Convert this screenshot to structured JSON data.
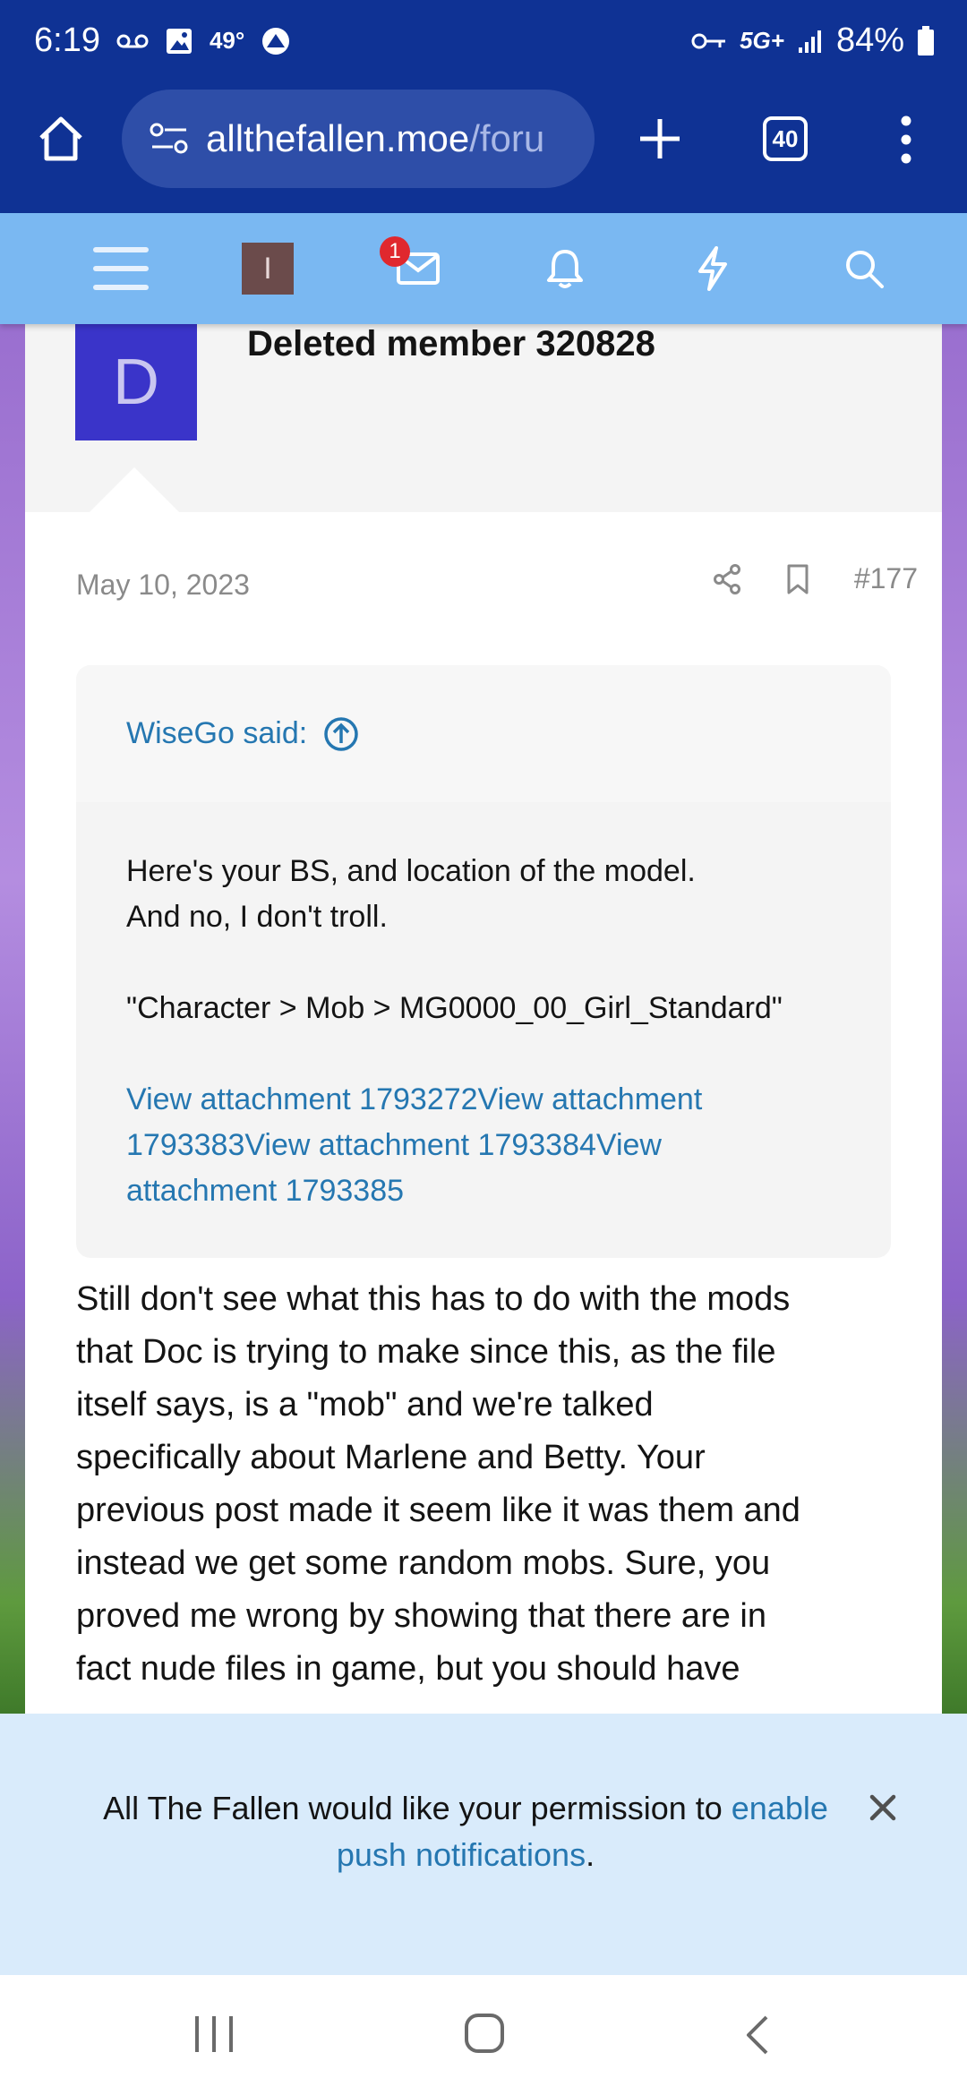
{
  "status_bar": {
    "time": "6:19",
    "temperature": "49°",
    "network": "5G+",
    "battery": "84%"
  },
  "browser": {
    "url_host": "allthefallen.moe",
    "url_path": "/foru",
    "tab_count": "40"
  },
  "site_nav": {
    "user_initial": "I",
    "inbox_badge": "1"
  },
  "post": {
    "avatar_letter": "D",
    "author": "Deleted member 320828",
    "date": "May 10, 2023",
    "post_number": "#177",
    "quote": {
      "attribution": "WiseGo said:",
      "line1": "Here's your BS, and location of the model.",
      "line2": "And no, I don't troll.",
      "line3": "\"Character > Mob > MG0000_00_Girl_Standard\"",
      "attachments_line1": "View attachment 1793272View attachment",
      "attachments_line2": "1793383View attachment 1793384View",
      "attachments_line3": "attachment 1793385"
    },
    "body_lines": [
      "Still don't see what this has to do with the mods",
      "that Doc is trying to make since this, as the file",
      "itself says, is a \"mob\" and we're talked",
      "specifically about Marlene and Betty. Your",
      "previous post made it seem like it was them and",
      "instead we get some random mobs. Sure, you",
      "proved me wrong by showing that there are in",
      "fact nude files in game, but you should have"
    ]
  },
  "push_banner": {
    "text": "All The Fallen would like your permission to",
    "link": "enable push notifications",
    "end": "."
  },
  "colors": {
    "chrome_blue": "#0f3294",
    "nav_blue": "#7ab8f2",
    "link_blue": "#2577b1",
    "avatar_purple": "#3a34c9",
    "badge_red": "#e0282e"
  }
}
